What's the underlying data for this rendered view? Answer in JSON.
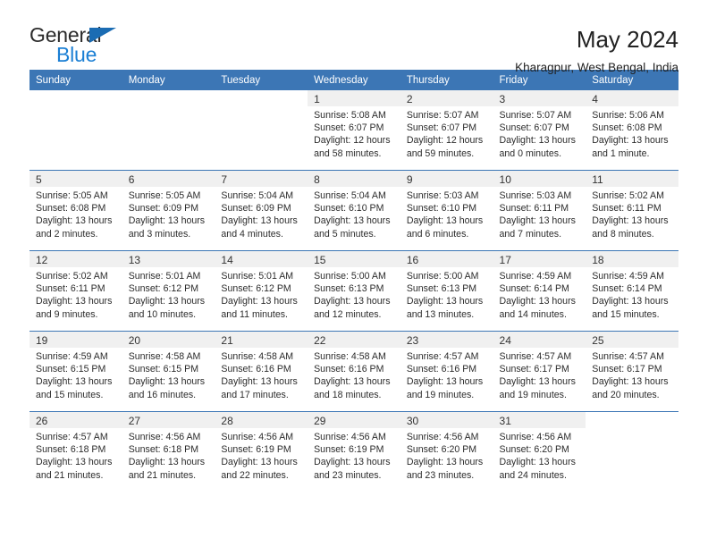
{
  "brand": {
    "name_part1": "General",
    "name_part2": "Blue",
    "triangle_color": "#1b6cb3",
    "blue_color": "#1b7fd4"
  },
  "header": {
    "title": "May 2024",
    "subtitle": "Kharagpur, West Bengal, India"
  },
  "theme": {
    "header_blue": "#3c76b5",
    "daynum_band": "#f0f0f0",
    "row_divider": "#3c76b5"
  },
  "weekday_headers": [
    "Sunday",
    "Monday",
    "Tuesday",
    "Wednesday",
    "Thursday",
    "Friday",
    "Saturday"
  ],
  "weeks": [
    [
      {
        "day": "",
        "sunrise": "",
        "sunset": "",
        "daylight_line1": "",
        "daylight_line2": ""
      },
      {
        "day": "",
        "sunrise": "",
        "sunset": "",
        "daylight_line1": "",
        "daylight_line2": ""
      },
      {
        "day": "",
        "sunrise": "",
        "sunset": "",
        "daylight_line1": "",
        "daylight_line2": ""
      },
      {
        "day": "1",
        "sunrise": "Sunrise: 5:08 AM",
        "sunset": "Sunset: 6:07 PM",
        "daylight_line1": "Daylight: 12 hours",
        "daylight_line2": "and 58 minutes."
      },
      {
        "day": "2",
        "sunrise": "Sunrise: 5:07 AM",
        "sunset": "Sunset: 6:07 PM",
        "daylight_line1": "Daylight: 12 hours",
        "daylight_line2": "and 59 minutes."
      },
      {
        "day": "3",
        "sunrise": "Sunrise: 5:07 AM",
        "sunset": "Sunset: 6:07 PM",
        "daylight_line1": "Daylight: 13 hours",
        "daylight_line2": "and 0 minutes."
      },
      {
        "day": "4",
        "sunrise": "Sunrise: 5:06 AM",
        "sunset": "Sunset: 6:08 PM",
        "daylight_line1": "Daylight: 13 hours",
        "daylight_line2": "and 1 minute."
      }
    ],
    [
      {
        "day": "5",
        "sunrise": "Sunrise: 5:05 AM",
        "sunset": "Sunset: 6:08 PM",
        "daylight_line1": "Daylight: 13 hours",
        "daylight_line2": "and 2 minutes."
      },
      {
        "day": "6",
        "sunrise": "Sunrise: 5:05 AM",
        "sunset": "Sunset: 6:09 PM",
        "daylight_line1": "Daylight: 13 hours",
        "daylight_line2": "and 3 minutes."
      },
      {
        "day": "7",
        "sunrise": "Sunrise: 5:04 AM",
        "sunset": "Sunset: 6:09 PM",
        "daylight_line1": "Daylight: 13 hours",
        "daylight_line2": "and 4 minutes."
      },
      {
        "day": "8",
        "sunrise": "Sunrise: 5:04 AM",
        "sunset": "Sunset: 6:10 PM",
        "daylight_line1": "Daylight: 13 hours",
        "daylight_line2": "and 5 minutes."
      },
      {
        "day": "9",
        "sunrise": "Sunrise: 5:03 AM",
        "sunset": "Sunset: 6:10 PM",
        "daylight_line1": "Daylight: 13 hours",
        "daylight_line2": "and 6 minutes."
      },
      {
        "day": "10",
        "sunrise": "Sunrise: 5:03 AM",
        "sunset": "Sunset: 6:11 PM",
        "daylight_line1": "Daylight: 13 hours",
        "daylight_line2": "and 7 minutes."
      },
      {
        "day": "11",
        "sunrise": "Sunrise: 5:02 AM",
        "sunset": "Sunset: 6:11 PM",
        "daylight_line1": "Daylight: 13 hours",
        "daylight_line2": "and 8 minutes."
      }
    ],
    [
      {
        "day": "12",
        "sunrise": "Sunrise: 5:02 AM",
        "sunset": "Sunset: 6:11 PM",
        "daylight_line1": "Daylight: 13 hours",
        "daylight_line2": "and 9 minutes."
      },
      {
        "day": "13",
        "sunrise": "Sunrise: 5:01 AM",
        "sunset": "Sunset: 6:12 PM",
        "daylight_line1": "Daylight: 13 hours",
        "daylight_line2": "and 10 minutes."
      },
      {
        "day": "14",
        "sunrise": "Sunrise: 5:01 AM",
        "sunset": "Sunset: 6:12 PM",
        "daylight_line1": "Daylight: 13 hours",
        "daylight_line2": "and 11 minutes."
      },
      {
        "day": "15",
        "sunrise": "Sunrise: 5:00 AM",
        "sunset": "Sunset: 6:13 PM",
        "daylight_line1": "Daylight: 13 hours",
        "daylight_line2": "and 12 minutes."
      },
      {
        "day": "16",
        "sunrise": "Sunrise: 5:00 AM",
        "sunset": "Sunset: 6:13 PM",
        "daylight_line1": "Daylight: 13 hours",
        "daylight_line2": "and 13 minutes."
      },
      {
        "day": "17",
        "sunrise": "Sunrise: 4:59 AM",
        "sunset": "Sunset: 6:14 PM",
        "daylight_line1": "Daylight: 13 hours",
        "daylight_line2": "and 14 minutes."
      },
      {
        "day": "18",
        "sunrise": "Sunrise: 4:59 AM",
        "sunset": "Sunset: 6:14 PM",
        "daylight_line1": "Daylight: 13 hours",
        "daylight_line2": "and 15 minutes."
      }
    ],
    [
      {
        "day": "19",
        "sunrise": "Sunrise: 4:59 AM",
        "sunset": "Sunset: 6:15 PM",
        "daylight_line1": "Daylight: 13 hours",
        "daylight_line2": "and 15 minutes."
      },
      {
        "day": "20",
        "sunrise": "Sunrise: 4:58 AM",
        "sunset": "Sunset: 6:15 PM",
        "daylight_line1": "Daylight: 13 hours",
        "daylight_line2": "and 16 minutes."
      },
      {
        "day": "21",
        "sunrise": "Sunrise: 4:58 AM",
        "sunset": "Sunset: 6:16 PM",
        "daylight_line1": "Daylight: 13 hours",
        "daylight_line2": "and 17 minutes."
      },
      {
        "day": "22",
        "sunrise": "Sunrise: 4:58 AM",
        "sunset": "Sunset: 6:16 PM",
        "daylight_line1": "Daylight: 13 hours",
        "daylight_line2": "and 18 minutes."
      },
      {
        "day": "23",
        "sunrise": "Sunrise: 4:57 AM",
        "sunset": "Sunset: 6:16 PM",
        "daylight_line1": "Daylight: 13 hours",
        "daylight_line2": "and 19 minutes."
      },
      {
        "day": "24",
        "sunrise": "Sunrise: 4:57 AM",
        "sunset": "Sunset: 6:17 PM",
        "daylight_line1": "Daylight: 13 hours",
        "daylight_line2": "and 19 minutes."
      },
      {
        "day": "25",
        "sunrise": "Sunrise: 4:57 AM",
        "sunset": "Sunset: 6:17 PM",
        "daylight_line1": "Daylight: 13 hours",
        "daylight_line2": "and 20 minutes."
      }
    ],
    [
      {
        "day": "26",
        "sunrise": "Sunrise: 4:57 AM",
        "sunset": "Sunset: 6:18 PM",
        "daylight_line1": "Daylight: 13 hours",
        "daylight_line2": "and 21 minutes."
      },
      {
        "day": "27",
        "sunrise": "Sunrise: 4:56 AM",
        "sunset": "Sunset: 6:18 PM",
        "daylight_line1": "Daylight: 13 hours",
        "daylight_line2": "and 21 minutes."
      },
      {
        "day": "28",
        "sunrise": "Sunrise: 4:56 AM",
        "sunset": "Sunset: 6:19 PM",
        "daylight_line1": "Daylight: 13 hours",
        "daylight_line2": "and 22 minutes."
      },
      {
        "day": "29",
        "sunrise": "Sunrise: 4:56 AM",
        "sunset": "Sunset: 6:19 PM",
        "daylight_line1": "Daylight: 13 hours",
        "daylight_line2": "and 23 minutes."
      },
      {
        "day": "30",
        "sunrise": "Sunrise: 4:56 AM",
        "sunset": "Sunset: 6:20 PM",
        "daylight_line1": "Daylight: 13 hours",
        "daylight_line2": "and 23 minutes."
      },
      {
        "day": "31",
        "sunrise": "Sunrise: 4:56 AM",
        "sunset": "Sunset: 6:20 PM",
        "daylight_line1": "Daylight: 13 hours",
        "daylight_line2": "and 24 minutes."
      },
      {
        "day": "",
        "sunrise": "",
        "sunset": "",
        "daylight_line1": "",
        "daylight_line2": ""
      }
    ]
  ]
}
